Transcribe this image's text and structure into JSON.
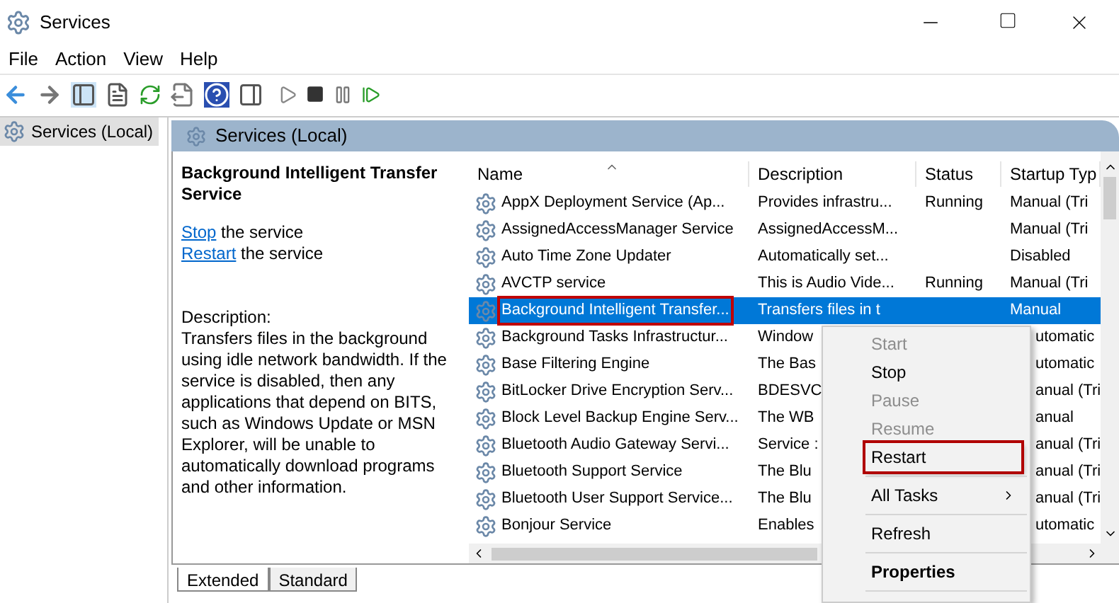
{
  "window": {
    "title": "Services"
  },
  "menu_bar": [
    "File",
    "Action",
    "View",
    "Help"
  ],
  "tree": {
    "items": [
      {
        "label": "Services (Local)",
        "selected": true
      }
    ]
  },
  "panel_header": "Services (Local)",
  "details": {
    "title": "Background Intelligent Transfer Service",
    "actions": [
      {
        "link": "Stop",
        "text": "the service"
      },
      {
        "link": "Restart",
        "text": "the service"
      }
    ],
    "description_label": "Description:",
    "description": "Transfers files in the background using idle network bandwidth. If the service is disabled, then any applications that depend on BITS, such as Windows Update or MSN Explorer, will be unable to automatically download programs and other information."
  },
  "table": {
    "columns": [
      "Name",
      "Description",
      "Status",
      "Startup Typ"
    ],
    "rows": [
      {
        "name": "AppX Deployment Service (Ap...",
        "description": "Provides infrastru...",
        "status": "Running",
        "startup": "Manual (Tri",
        "selected": false,
        "highlighted": false
      },
      {
        "name": "AssignedAccessManager Service",
        "description": "AssignedAccessM...",
        "status": "",
        "startup": "Manual (Tri",
        "selected": false,
        "highlighted": false
      },
      {
        "name": "Auto Time Zone Updater",
        "description": "Automatically set...",
        "status": "",
        "startup": "Disabled",
        "selected": false,
        "highlighted": false
      },
      {
        "name": "AVCTP service",
        "description": "This is Audio Vide...",
        "status": "Running",
        "startup": "Manual (Tri",
        "selected": false,
        "highlighted": false
      },
      {
        "name": "Background Intelligent Transfer...",
        "description": "Transfers files in t",
        "status": "",
        "startup": "Manual",
        "selected": true,
        "highlighted": true
      },
      {
        "name": "Background Tasks Infrastructur...",
        "description": "Window",
        "status": "",
        "startup": "utomatic",
        "selected": false,
        "highlighted": false
      },
      {
        "name": "Base Filtering Engine",
        "description": "The Bas",
        "status": "",
        "startup": "utomatic",
        "selected": false,
        "highlighted": false
      },
      {
        "name": "BitLocker Drive Encryption Serv...",
        "description": "BDESVC",
        "status": "",
        "startup": "anual (Tri",
        "selected": false,
        "highlighted": false
      },
      {
        "name": "Block Level Backup Engine Serv...",
        "description": "The WB",
        "status": "",
        "startup": "anual",
        "selected": false,
        "highlighted": false
      },
      {
        "name": "Bluetooth Audio Gateway Servi...",
        "description": "Service :",
        "status": "",
        "startup": "anual (Tri",
        "selected": false,
        "highlighted": false
      },
      {
        "name": "Bluetooth Support Service",
        "description": "The Blu",
        "status": "",
        "startup": "anual (Tri",
        "selected": false,
        "highlighted": false
      },
      {
        "name": "Bluetooth User Support Service...",
        "description": "The Blu",
        "status": "",
        "startup": "anual (Tri",
        "selected": false,
        "highlighted": false
      },
      {
        "name": "Bonjour Service",
        "description": "Enables",
        "status": "",
        "startup": "utomatic",
        "selected": false,
        "highlighted": false
      }
    ]
  },
  "context_menu": [
    {
      "kind": "item",
      "label": "Start",
      "disabled": true,
      "bold": false,
      "highlighted": false
    },
    {
      "kind": "item",
      "label": "Stop",
      "disabled": false,
      "bold": false,
      "highlighted": false
    },
    {
      "kind": "item",
      "label": "Pause",
      "disabled": true,
      "bold": false,
      "highlighted": false
    },
    {
      "kind": "item",
      "label": "Resume",
      "disabled": true,
      "bold": false,
      "highlighted": false
    },
    {
      "kind": "item",
      "label": "Restart",
      "disabled": false,
      "bold": false,
      "highlighted": true
    },
    {
      "kind": "separator"
    },
    {
      "kind": "submenu",
      "label": "All Tasks",
      "disabled": false,
      "bold": false,
      "highlighted": false
    },
    {
      "kind": "separator"
    },
    {
      "kind": "item",
      "label": "Refresh",
      "disabled": false,
      "bold": false,
      "highlighted": false
    },
    {
      "kind": "separator"
    },
    {
      "kind": "item",
      "label": "Properties",
      "disabled": false,
      "bold": true,
      "highlighted": false
    },
    {
      "kind": "separator"
    }
  ],
  "view_tabs": [
    {
      "label": "Extended",
      "selected": true
    },
    {
      "label": "Standard",
      "selected": false
    }
  ]
}
